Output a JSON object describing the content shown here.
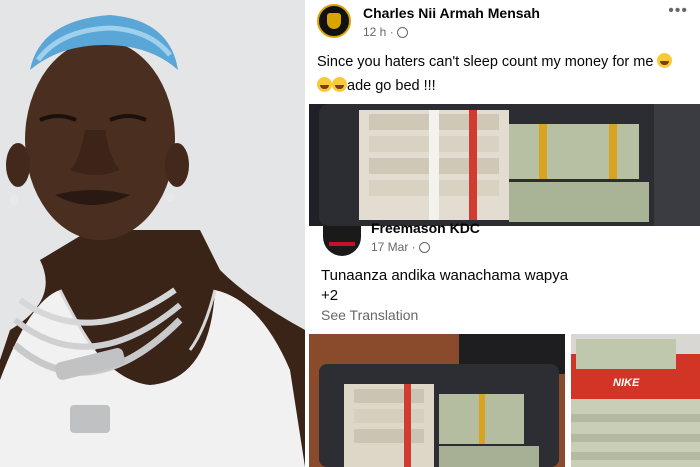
{
  "post1": {
    "author": "Charles Nii Armah Mensah",
    "time": "12 h ·",
    "more": "•••",
    "text_line1": "Since you haters  can't sleep count my money for me",
    "text_line2": "ade go bed !!!"
  },
  "post2": {
    "author": "Freemason KDC",
    "time": "17 Mar ·",
    "text_line1": "Tunaanza andika wanachama wapya",
    "text_line2": "+2",
    "see_translation": "See Translation"
  },
  "shoebox_brand": "NIKE"
}
